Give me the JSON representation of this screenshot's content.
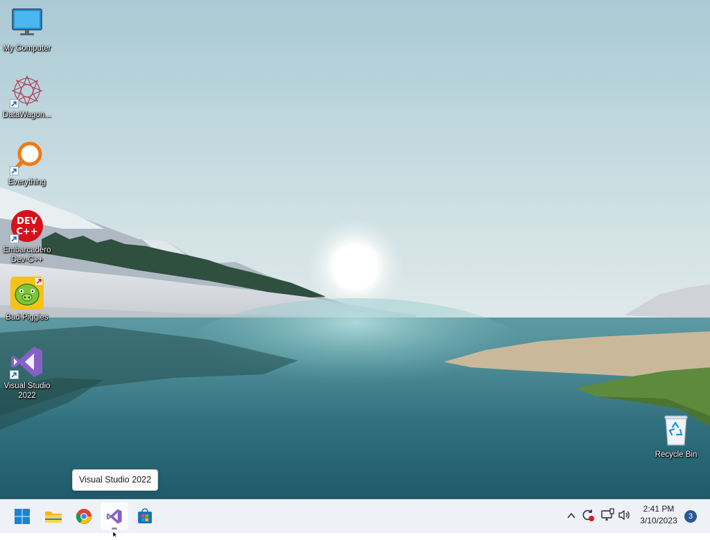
{
  "desktop": {
    "icons": [
      {
        "label": "My Computer",
        "icon": "monitor-icon"
      },
      {
        "label": "DataWagon...",
        "icon": "star-pattern-icon"
      },
      {
        "label": "Everything",
        "icon": "magnifier-icon"
      },
      {
        "label": "Embarcadero\nDev-C++",
        "icon": "devcpp-icon",
        "badge_text": "DEV\nC++"
      },
      {
        "label": "Bad Piggies",
        "icon": "green-pig-icon"
      },
      {
        "label": "Visual Studio\n2022",
        "icon": "visual-studio-icon"
      },
      {
        "label": "Recycle Bin",
        "icon": "recycle-bin-icon"
      }
    ]
  },
  "tooltip": {
    "text": "Visual Studio 2022"
  },
  "taskbar": {
    "pinned": [
      {
        "name": "Start",
        "icon": "windows-start-icon"
      },
      {
        "name": "File Explorer",
        "icon": "folder-icon"
      },
      {
        "name": "Google Chrome",
        "icon": "chrome-icon"
      },
      {
        "name": "Visual Studio 2022",
        "icon": "visual-studio-icon",
        "active": true
      },
      {
        "name": "Microsoft Store",
        "icon": "store-icon"
      }
    ],
    "tray": [
      {
        "name": "show-hidden-icons",
        "icon": "chevron-up-icon"
      },
      {
        "name": "update",
        "icon": "sync-alert-icon"
      },
      {
        "name": "network",
        "icon": "network-icon"
      },
      {
        "name": "volume",
        "icon": "speaker-icon"
      }
    ],
    "clock": {
      "time": "2:41 PM",
      "date": "3/10/2023"
    },
    "notifications": {
      "count": "3"
    }
  },
  "colors": {
    "taskbar_bg": "#eef2f7",
    "notification_badge": "#2b5797",
    "visual_studio_purple": "#8661c5"
  }
}
